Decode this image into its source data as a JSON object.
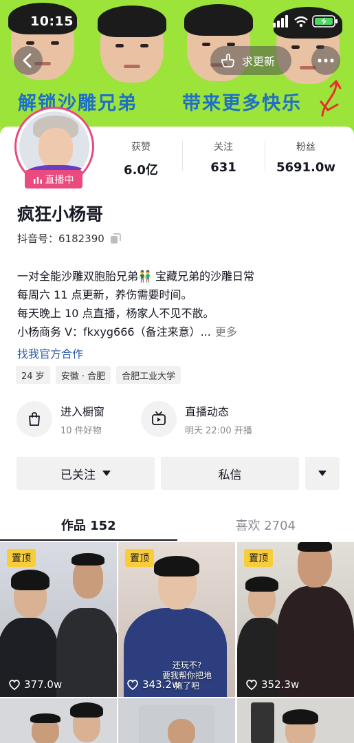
{
  "status_bar": {
    "time": "10:15"
  },
  "banner": {
    "left_text": "解锁沙雕兄弟",
    "right_text": "带来更多快乐",
    "request_update_label": "求更新"
  },
  "profile": {
    "live_label": "直播中",
    "name": "疯狂小杨哥",
    "douyin_id": "抖音号：6182390",
    "stats": [
      {
        "label": "获赞",
        "value": "6.0亿"
      },
      {
        "label": "关注",
        "value": "631"
      },
      {
        "label": "粉丝",
        "value": "5691.0w"
      }
    ],
    "bio_lines": [
      "一对全能沙雕双胞胎兄弟👬 宝藏兄弟的沙雕日常",
      "每周六 11 点更新，养伤需要时间。",
      "每天晚上 10 点直播，杨家人不见不散。",
      "小杨商务 V：fkxyg666（备注来意）..."
    ],
    "bio_more": "更多",
    "official_link": "找我官方合作",
    "tags": [
      "24 岁",
      "安徽 · 合肥",
      "合肥工业大学"
    ]
  },
  "features": [
    {
      "title": "进入橱窗",
      "subtitle": "10 件好物",
      "icon": "shopping-bag-icon"
    },
    {
      "title": "直播动态",
      "subtitle": "明天 22:00 开播",
      "icon": "tv-icon"
    }
  ],
  "actions": {
    "followed_label": "已关注",
    "message_label": "私信"
  },
  "tabs": [
    {
      "label": "作品 152",
      "active": true
    },
    {
      "label": "喜欢 2704",
      "active": false
    }
  ],
  "videos": [
    {
      "pinned_label": "置顶",
      "likes": "377.0w",
      "caption": ""
    },
    {
      "pinned_label": "置顶",
      "likes": "343.2w",
      "caption": "还玩不?\n要我帮你把地拖了吧"
    },
    {
      "pinned_label": "置顶",
      "likes": "352.3w",
      "caption": ""
    }
  ],
  "colors": {
    "banner_green": "#9ce33a",
    "live_pink": "#ea4a7e",
    "pin_yellow": "#f9cd3a",
    "link_blue": "#2f5ea8",
    "banner_text_blue": "#1e6fc8"
  }
}
